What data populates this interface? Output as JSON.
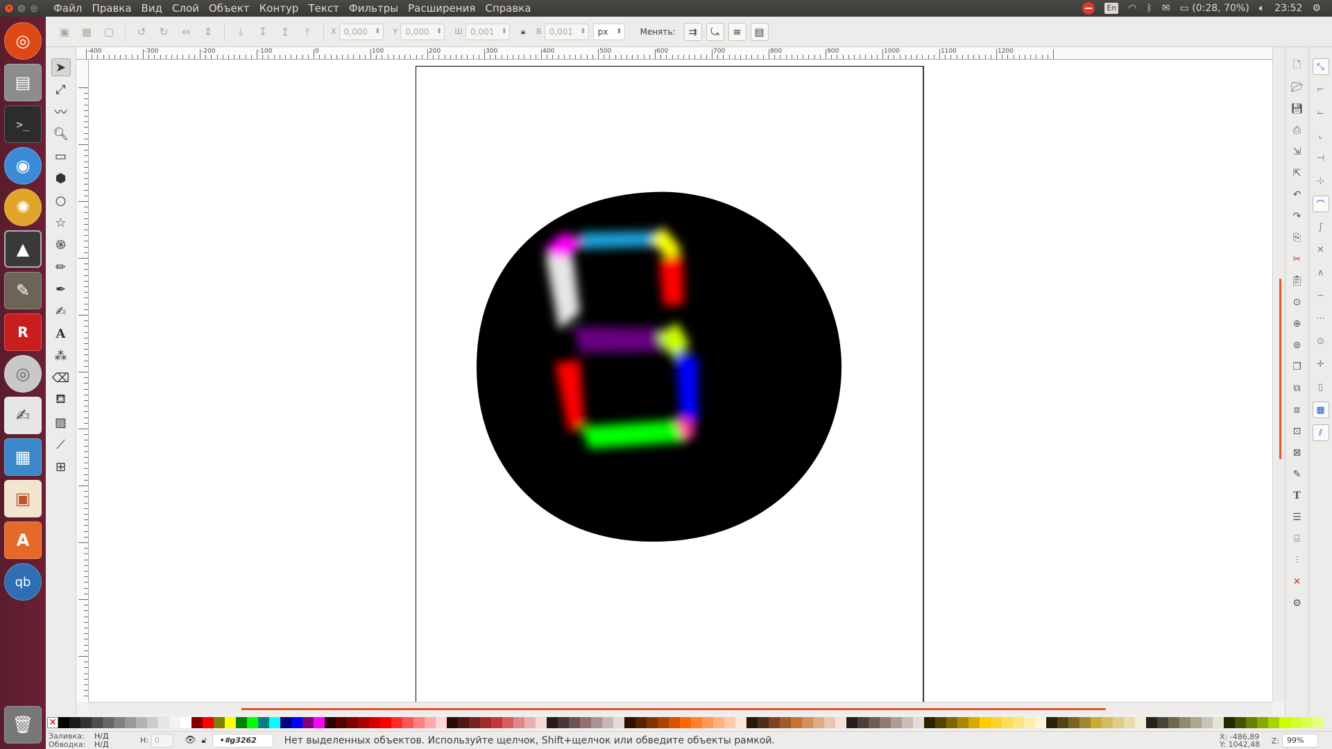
{
  "menubar": {
    "items": [
      "Файл",
      "Правка",
      "Вид",
      "Слой",
      "Объект",
      "Контур",
      "Текст",
      "Фильтры",
      "Расширения",
      "Справка"
    ]
  },
  "indicators": {
    "lang": "En",
    "battery": "(0:28, 70%)",
    "clock": "23:52"
  },
  "launcher": {
    "apps": [
      "ubuntu-dash",
      "files",
      "terminal",
      "chromium",
      "blender",
      "inkscape",
      "gimp",
      "rhythmbox",
      "disks",
      "text-editor",
      "image-viewer",
      "impress",
      "software-center",
      "qbittorrent"
    ]
  },
  "commandbar": {
    "x_label": "X",
    "x_value": "0,000",
    "y_label": "Y",
    "y_value": "0,000",
    "w_label": "Ш",
    "w_value": "0,001",
    "h_label": "В",
    "h_value": "0,001",
    "unit": "px",
    "change_label": "Менять:"
  },
  "ruler": {
    "top_labels": [
      "-400",
      "-300",
      "-200",
      "-100",
      "0",
      "100",
      "200",
      "300",
      "400",
      "500",
      "600",
      "700",
      "800",
      "900",
      "1000",
      "1100",
      "1200"
    ]
  },
  "artwork": {
    "background": "#000000",
    "segments": [
      {
        "name": "top",
        "color": "#1aa3d9"
      },
      {
        "name": "top-left-corner",
        "color": "#ff00ff"
      },
      {
        "name": "top-right-corner",
        "color": "#ffff00"
      },
      {
        "name": "upper-left",
        "color": "#e6e6e6"
      },
      {
        "name": "upper-right",
        "color": "#ff0000"
      },
      {
        "name": "middle",
        "color": "#660080"
      },
      {
        "name": "middle-right-corner",
        "color": "#ccff00"
      },
      {
        "name": "lower-left",
        "color": "#ff0000"
      },
      {
        "name": "lower-right",
        "color": "#0000ff"
      },
      {
        "name": "bottom",
        "color": "#00ff00"
      },
      {
        "name": "bottom-right-corner",
        "color": "#ff3399"
      }
    ]
  },
  "palette": {
    "swatches": [
      "#000000",
      "#1a1a1a",
      "#333333",
      "#4d4d4d",
      "#666666",
      "#808080",
      "#999999",
      "#b3b3b3",
      "#cccccc",
      "#e6e6e6",
      "#f2f2f2",
      "#ffffff",
      "#800000",
      "#ff0000",
      "#808000",
      "#ffff00",
      "#008000",
      "#00ff00",
      "#008080",
      "#00ffff",
      "#000080",
      "#0000ff",
      "#800080",
      "#ff00ff",
      "#2b0000",
      "#550000",
      "#800000",
      "#aa0000",
      "#d40000",
      "#ff0000",
      "#ff2a2a",
      "#ff5555",
      "#ff8080",
      "#ffaaaa",
      "#ffd5d5",
      "#280b0b",
      "#501616",
      "#782121",
      "#a02c2c",
      "#c83737",
      "#d35f5f",
      "#de8787",
      "#e9afaf",
      "#f4d7d7",
      "#241c1c",
      "#483737",
      "#6c5353",
      "#916f6f",
      "#ac9393",
      "#c8b7b7",
      "#e3dbdb",
      "#2b1100",
      "#552200",
      "#803300",
      "#aa4400",
      "#d45500",
      "#ff6600",
      "#ff7f2a",
      "#ff9955",
      "#ffb380",
      "#ffccaa",
      "#ffe6d5",
      "#28170b",
      "#502d16",
      "#784421",
      "#a05a2c",
      "#c87137",
      "#d38d5f",
      "#deaa87",
      "#e9c6af",
      "#f4e3d7",
      "#241f1c",
      "#483e37",
      "#6c5d53",
      "#917c6f",
      "#ac9d93",
      "#c8beb7",
      "#e3dedb",
      "#2b2200",
      "#554400",
      "#806600",
      "#aa8800",
      "#d4aa00",
      "#ffcc00",
      "#ffd42a",
      "#ffdd55",
      "#ffe680",
      "#ffeeaa",
      "#fff6d5",
      "#28220b",
      "#504416",
      "#786721",
      "#a0892c",
      "#c8ab37",
      "#d3bc5f",
      "#decd87",
      "#e9ddaf",
      "#f4eed7",
      "#24221c",
      "#484537",
      "#6c6753",
      "#918a6f",
      "#aca793",
      "#c8c4b7",
      "#e3e2db",
      "#222b00",
      "#445500",
      "#668000",
      "#88aa00",
      "#aad400",
      "#ccff00",
      "#d4ff2a",
      "#ddff55",
      "#e5ff80"
    ]
  },
  "statusbar": {
    "fill_label": "Заливка:",
    "fill_value": "Н/Д",
    "stroke_label": "Обводка:",
    "stroke_value": "Н/Д",
    "opacity_label": "Н:",
    "opacity_value": "0",
    "layer": "•#g3262",
    "message": "Нет выделенных объектов. Используйте щелчок, Shift+щелчок или обведите объекты рамкой.",
    "coord_x": "X: -486,89",
    "coord_y": "Y: 1042,48",
    "zoom_label": "Z:",
    "zoom_value": "99%"
  }
}
